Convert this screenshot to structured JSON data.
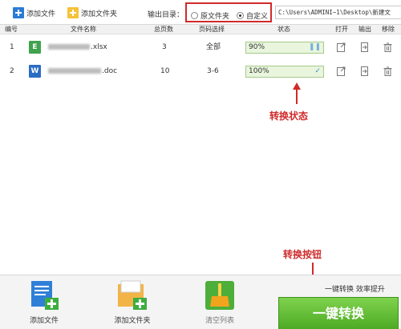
{
  "toolbar": {
    "add_file": "添加文件",
    "add_folder": "添加文件夹",
    "output_dir_label": "输出目录：",
    "radio_original": "原文件夹",
    "radio_custom": "自定义",
    "output_path": "C:\\Users\\ADMINI~1\\Desktop\\新建文"
  },
  "table": {
    "headers": {
      "num": "编号",
      "name": "文件名称",
      "pages": "总页数",
      "range": "页码选择",
      "status": "状态",
      "open": "打开",
      "output": "输出",
      "remove": "移除"
    },
    "rows": [
      {
        "num": "1",
        "icon_letter": "E",
        "name_suffix": ".xlsx",
        "pages": "3",
        "range": "全部",
        "status": "90%",
        "progress": 0.9,
        "state": "paused"
      },
      {
        "num": "2",
        "icon_letter": "W",
        "name_suffix": ".doc",
        "pages": "10",
        "range": "3-6",
        "status": "100%",
        "progress": 1.0,
        "state": "done"
      }
    ]
  },
  "annotations": {
    "status": "转换状态",
    "convert": "转换按钮"
  },
  "bottom": {
    "add_file": "添加文件",
    "add_folder": "添加文件夹",
    "clear_list": "清空列表",
    "hint": "一键转换  效率提升",
    "convert": "一键转换"
  },
  "colors": {
    "accent_red": "#d02a2a",
    "excel_green": "#3fa34d",
    "word_blue": "#2b6cc4",
    "convert_green": "#5cba2e"
  }
}
